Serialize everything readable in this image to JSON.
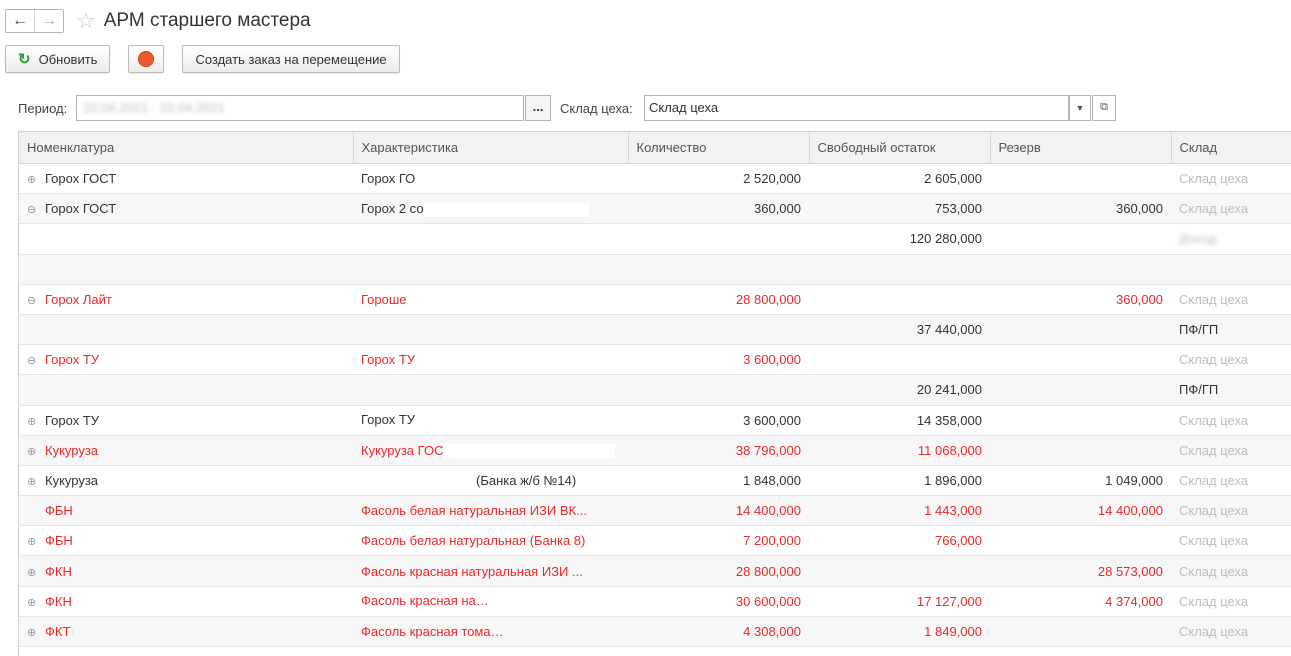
{
  "window": {
    "title": "АРМ старшего мастера"
  },
  "toolbar": {
    "refresh_label": "Обновить",
    "create_label": "Создать заказ на перемещение"
  },
  "filters": {
    "period_label": "Период:",
    "period_value": "22.04.2021 - 22.04.2021",
    "period_select": "...",
    "warehouse_label": "Склад цеха:",
    "warehouse_value": "Склад цеха"
  },
  "table": {
    "columns": [
      "Номенклатура",
      "Характеристика",
      "Количество",
      "Свободный остаток",
      "Резерв",
      "Склад"
    ],
    "rows": [
      {
        "expand": "plus",
        "color": "dark",
        "nom": "Горох ГОСТ",
        "char": "Горох ГО",
        "qty": "2 520,000",
        "free": "2 605,000",
        "res": "",
        "wh": "Склад цеха"
      },
      {
        "expand": "minus",
        "color": "dark",
        "nom": "Горох ГОСТ",
        "char": "Горох 2 со",
        "qty": "360,000",
        "free": "753,000",
        "res": "360,000",
        "wh": "Склад цеха"
      },
      {
        "expand": "none",
        "color": "dark",
        "nom": "",
        "char": "",
        "qty": "",
        "free": "120 280,000",
        "res": "",
        "wh": "Доход"
      },
      {
        "expand": "none",
        "color": "dark",
        "nom": "",
        "char": "",
        "qty": "",
        "free": "",
        "res": "",
        "wh": ""
      },
      {
        "expand": "minus",
        "color": "red",
        "nom": "Горох Лайт",
        "char": "Гороше",
        "qty": "28 800,000",
        "free": "",
        "res": "360,000",
        "wh": "Склад цеха"
      },
      {
        "expand": "none",
        "color": "dark",
        "nom": "",
        "char": "",
        "qty": "",
        "free": "37 440,000",
        "res": "",
        "wh": "ПФ/ГП"
      },
      {
        "expand": "minus",
        "color": "red",
        "nom": "Горох ТУ",
        "char": "Горох ТУ",
        "qty": "3 600,000",
        "free": "",
        "res": "",
        "wh": "Склад цеха"
      },
      {
        "expand": "none",
        "color": "dark",
        "nom": "",
        "char": "",
        "qty": "",
        "free": "20 241,000",
        "res": "",
        "wh": "ПФ/ГП"
      },
      {
        "expand": "plus",
        "color": "dark",
        "nom": "Горох ТУ",
        "char": "Горох ТУ",
        "qty": "3 600,000",
        "free": "14 358,000",
        "res": "",
        "wh": "Склад цеха"
      },
      {
        "expand": "plus",
        "color": "red",
        "nom": "Кукуруза",
        "char": "Кукуруза ГОС",
        "qty": "38 796,000",
        "free": "11 068,000",
        "res": "",
        "wh": "Склад цеха"
      },
      {
        "expand": "plus",
        "color": "dark",
        "nom": "Кукуруза",
        "char": "(Банка ж/б №14)",
        "qty": "1 848,000",
        "free": "1 896,000",
        "res": "1 049,000",
        "wh": "Склад цеха"
      },
      {
        "expand": "none",
        "color": "red",
        "nom": "ФБН",
        "char": "Фасоль белая натуральная ИЗИ ВК...",
        "qty": "14 400,000",
        "free": "1 443,000",
        "res": "14 400,000",
        "wh": "Склад цеха"
      },
      {
        "expand": "plus",
        "color": "red",
        "nom": "ФБН",
        "char": "Фасоль белая натуральная (Банка 8)",
        "qty": "7 200,000",
        "free": "766,000",
        "res": "",
        "wh": "Склад цеха"
      },
      {
        "expand": "plus",
        "color": "red",
        "nom": "ФКН",
        "char": "Фасоль красная натуральная ИЗИ ...",
        "qty": "28 800,000",
        "free": "",
        "res": "28 573,000",
        "wh": "Склад цеха"
      },
      {
        "expand": "plus",
        "color": "red",
        "nom": "ФКН",
        "char": "Фасоль красная на",
        "qty": "30 600,000",
        "free": "17 127,000",
        "res": "4 374,000",
        "wh": "Склад цеха"
      },
      {
        "expand": "plus",
        "color": "red",
        "nom": "ФКТ",
        "char": "Фасоль красная тома",
        "qty": "4 308,000",
        "free": "1 849,000",
        "res": "",
        "wh": "Склад цеха"
      }
    ]
  }
}
